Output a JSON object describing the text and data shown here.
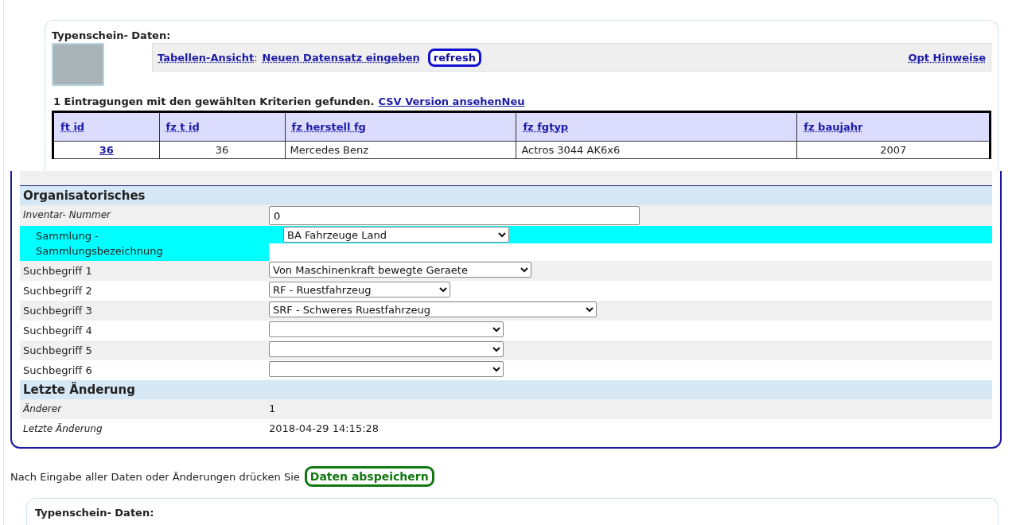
{
  "top_panel": {
    "title": "Typenschein- Daten:",
    "nav": {
      "table_view": "Tabellen-Ansicht",
      "separator": ":",
      "new_record": "Neuen Datensatz eingeben",
      "refresh": "refresh",
      "hints": "Opt Hinweise"
    },
    "result": {
      "text": "1 Eintragungen mit den gewählten Kriterien gefunden.",
      "csv_link": "CSV Version ansehenNeu"
    },
    "table": {
      "columns": [
        "ft id",
        "fz t id",
        "fz herstell fg",
        "fz fgtyp",
        "fz baujahr"
      ],
      "rows": [
        [
          "36",
          "36",
          "Mercedes Benz",
          "Actros 3044 AK6x6",
          "2007"
        ]
      ]
    }
  },
  "form": {
    "sections": [
      {
        "title": "Organisatorisches",
        "rows": [
          {
            "label": "Inventar- Nummer",
            "kind": "input",
            "value": "0",
            "highlighted": false
          },
          {
            "label": "Sammlung - Sammlungsbezeichnung",
            "kind": "select",
            "value": "BA Fahrzeuge Land",
            "highlighted": true
          },
          {
            "label": "Suchbegriff 1",
            "kind": "select",
            "value": "Von Maschinenkraft bewegte Geraete",
            "highlighted": false
          },
          {
            "label": "Suchbegriff 2",
            "kind": "select",
            "value": "RF - Ruestfahrzeug",
            "highlighted": false
          },
          {
            "label": "Suchbegriff 3",
            "kind": "select",
            "value": "SRF - Schweres Ruestfahrzeug",
            "highlighted": false
          },
          {
            "label": "Suchbegriff 4",
            "kind": "select",
            "highlighted": false
          },
          {
            "label": "Suchbegriff 5",
            "kind": "select",
            "highlighted": false
          },
          {
            "label": "Suchbegriff 6",
            "kind": "select",
            "highlighted": false
          }
        ]
      },
      {
        "title": "Letzte Änderung",
        "rows": [
          {
            "label": "Änderer",
            "kind": "text",
            "value": "1",
            "highlighted": false
          },
          {
            "label": "Letzte Änderung",
            "kind": "text",
            "value": "2018-04-29 14:15:28",
            "highlighted": false
          }
        ]
      }
    ]
  },
  "save": {
    "text": "Nach Eingabe aller Daten oder Änderungen drücken Sie",
    "button": "Daten abspeichern"
  },
  "bottom_panel": {
    "title": "Typenschein- Daten:"
  }
}
